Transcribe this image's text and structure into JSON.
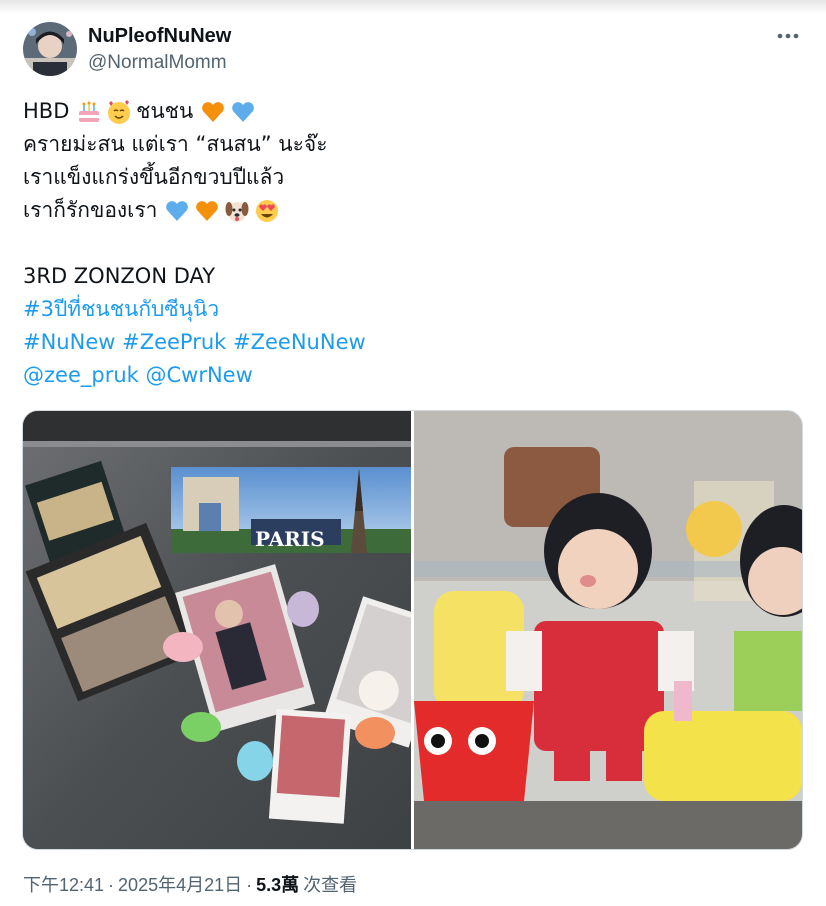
{
  "author": {
    "display_name": "NuPleofNuNew",
    "handle": "@NormalMomm",
    "avatar_icon": "profile-avatar"
  },
  "more_icon": "more-icon",
  "tweet": {
    "line1_prefix": "HBD",
    "line1_word": "ชนชน",
    "line2": "ครายม่ะสน แต่เรา “สนสน” นะจ๊ะ",
    "line3": "เราแข็งแกร่งขึ้นอีกขวบปีแล้ว",
    "line4": "เราก็รักของเรา",
    "line5": "3RD ZONZON DAY",
    "hashtag1": "#3ปีที่ชนชนกับซีนุนิว",
    "hashtag2": "#NuNew",
    "hashtag3": "#ZeePruk",
    "hashtag4": "#ZeeNuNew",
    "mention1": "@zee_pruk",
    "mention2": "@CwrNew",
    "emoji_icons": [
      "birthday-cake-icon",
      "smiling-face-with-hearts-icon",
      "orange-heart-icon",
      "blue-heart-icon",
      "dog-face-icon",
      "heart-eyes-icon"
    ]
  },
  "media": {
    "left_sign_text": "PARIS"
  },
  "meta": {
    "time": "下午12:41",
    "date": "2025年4月21日",
    "views_count": "5.3萬",
    "views_label": "次查看"
  },
  "colors": {
    "link": "#1d9bf0",
    "secondary_text": "#536471",
    "primary_text": "#0f1419"
  }
}
